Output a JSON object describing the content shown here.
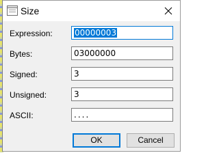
{
  "window": {
    "title": "Size",
    "icon": "window-icon",
    "close_icon": "close-icon"
  },
  "fields": [
    {
      "label": "Expression:",
      "value": "00000003"
    },
    {
      "label": "Bytes:",
      "value": "03000000"
    },
    {
      "label": "Signed:",
      "value": "3"
    },
    {
      "label": "Unsigned:",
      "value": "3"
    },
    {
      "label": "ASCII:",
      "value": "...."
    }
  ],
  "buttons": {
    "ok": "OK",
    "cancel": "Cancel"
  },
  "colors": {
    "accent": "#0078d7",
    "dialog_bg": "#f0f0f0"
  }
}
